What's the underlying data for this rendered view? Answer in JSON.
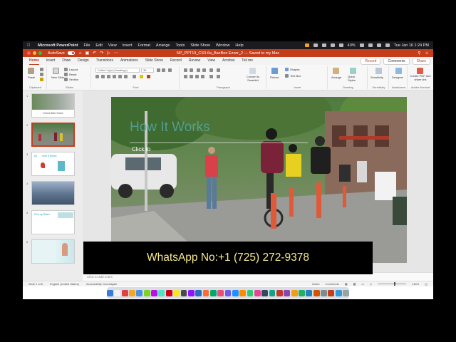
{
  "menubar": {
    "items": [
      "Microsoft PowerPoint",
      "File",
      "Edit",
      "View",
      "Insert",
      "Format",
      "Arrange",
      "Tools",
      "Slide Show",
      "Window",
      "Help"
    ],
    "datetime": "Tue Jan 16  1:24 PM",
    "battery": "40%"
  },
  "titlebar": {
    "autosave": "AutoSave",
    "doc_title": "NP_PPT19_CS3-6a_BazBen Ezzor_2 — Saved to my Mac",
    "right_icons": [
      "search-icon",
      "share-icon"
    ]
  },
  "tabs": {
    "items": [
      "Home",
      "Insert",
      "Draw",
      "Design",
      "Transitions",
      "Animations",
      "Slide Show",
      "Record",
      "Review",
      "View",
      "Acrobat",
      "Tell me"
    ],
    "record": "Record",
    "comments": "Comments",
    "share": "Share"
  },
  "ribbon": {
    "paste": "Paste",
    "new_slide": "New Slide",
    "layout": "Layout",
    "reset": "Reset",
    "section": "Section",
    "font_name": "Calibri Light (Headings)",
    "font_size": "36",
    "convert_smartart": "Convert to SmartArt",
    "picture": "Picture",
    "shapes": "Shapes",
    "text_box": "Text Box",
    "arrange": "Arrange",
    "quick_styles": "Quick Styles",
    "sensitivity": "Sensitivity",
    "designer": "Designer",
    "create_pdf": "Create PDF and share link",
    "groups": {
      "clipboard": "Clipboard",
      "slides": "Slides",
      "font": "Font",
      "paragraph": "Paragraph",
      "insert": "Insert",
      "drawing": "Drawing",
      "sensitivity": "Sensitivity",
      "assistance": "Assistance",
      "adobe": "Adobe Acrobat"
    }
  },
  "thumbnails": {
    "numbers": [
      "1",
      "2",
      "3",
      "4",
      "5",
      "6"
    ],
    "slide1_caption": "Detroit Bike Share",
    "slide3_caption": "How it Works",
    "slide5_caption": "Pick-up Rides"
  },
  "slide": {
    "title": "How It Works",
    "subtitle_placeholder": "Click to"
  },
  "notes": {
    "placeholder": "Click to add notes"
  },
  "statusbar": {
    "slide_info": "Slide 2 of 6",
    "language": "English (United States)",
    "accessibility": "Accessibility: Investigate",
    "notes": "Notes",
    "comments": "Comments",
    "zoom": "116%",
    "zoom_level_pct": 60
  },
  "overlay": {
    "text": "WhatsApp No:+1 (725) 272-9378"
  },
  "colors": {
    "accent": "#c43e1c",
    "title_teal": "#57a6a0",
    "overlay_text": "#f5e98f"
  }
}
